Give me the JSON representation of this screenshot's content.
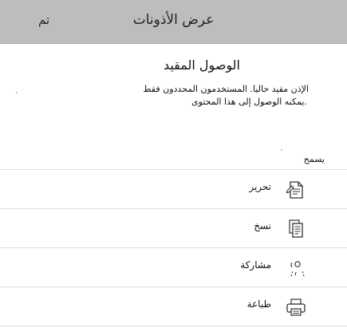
{
  "header": {
    "title": "عرض الأذونات",
    "done_label": "تم"
  },
  "restricted": {
    "title": "الوصول المقيد",
    "description_line1": "الإذن مقيد حاليا. المستخدمون المحددون فقط",
    "description_line2": "يمكنه الوصول إلى هذا المحتوى."
  },
  "permissions": {
    "allow_label": "يسمح",
    "items": [
      {
        "label": "تحرير",
        "icon": "edit-document-icon"
      },
      {
        "label": "نسخ",
        "icon": "copy-icon"
      },
      {
        "label": "مشاركة",
        "icon": "share-icon"
      },
      {
        "label": "طباعة",
        "icon": "print-icon"
      }
    ]
  }
}
